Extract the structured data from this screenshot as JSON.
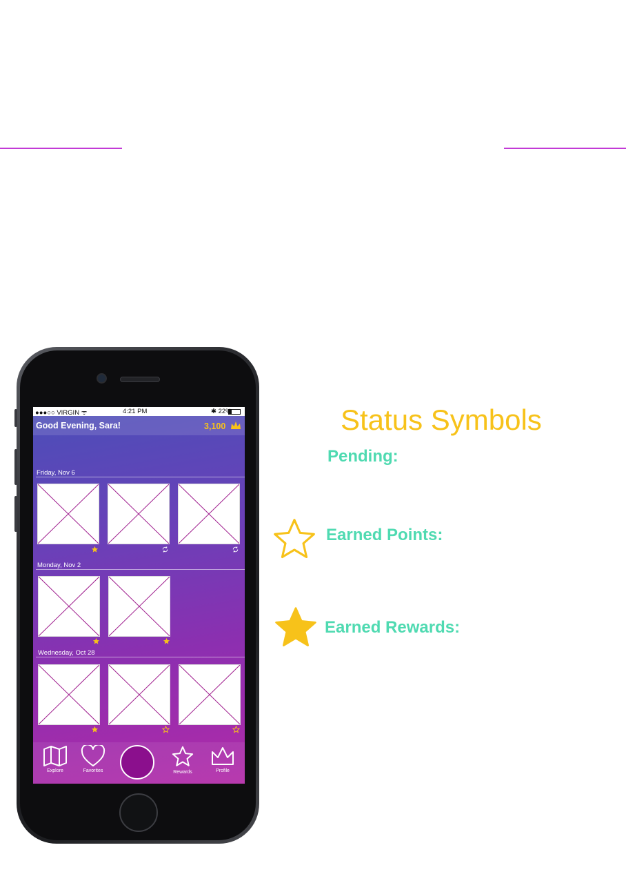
{
  "phone": {
    "status_bar": {
      "carrier": "●●●○○ VIRGIN ᯤ",
      "time": "4:21 PM",
      "battery": "✱ 22%"
    },
    "header": {
      "greeting": "Good Evening, Sara!",
      "points": "3,100"
    },
    "sections": [
      {
        "date": "Friday, Nov 6",
        "items": [
          {
            "status": "star-filled-icon"
          },
          {
            "status": "refresh-icon"
          },
          {
            "status": "refresh-icon"
          }
        ]
      },
      {
        "date": "Monday, Nov 2",
        "items": [
          {
            "status": "star-filled-icon"
          },
          {
            "status": "star-filled-icon"
          }
        ]
      },
      {
        "date": "Wednesday, Oct 28",
        "items": [
          {
            "status": "star-filled-icon"
          },
          {
            "status": "star-outline-icon"
          },
          {
            "status": "star-outline-icon"
          }
        ]
      }
    ],
    "tabs": [
      {
        "label": "Explore",
        "icon": "map-icon"
      },
      {
        "label": "Favorites",
        "icon": "heart-icon"
      },
      {
        "label": "",
        "icon": "capture-button"
      },
      {
        "label": "Rewards",
        "icon": "star-icon"
      },
      {
        "label": "Profile",
        "icon": "crown-icon"
      }
    ]
  },
  "legend": {
    "title": "Status Symbols",
    "pending_label": "Pending:",
    "points_label": "Earned Points:",
    "rewards_label": "Earned Rewards:"
  },
  "colors": {
    "accent_line": "#c23ad6",
    "gold": "#f7c21a",
    "teal": "#4fdab1",
    "capture_button": "#8b0f8d"
  }
}
